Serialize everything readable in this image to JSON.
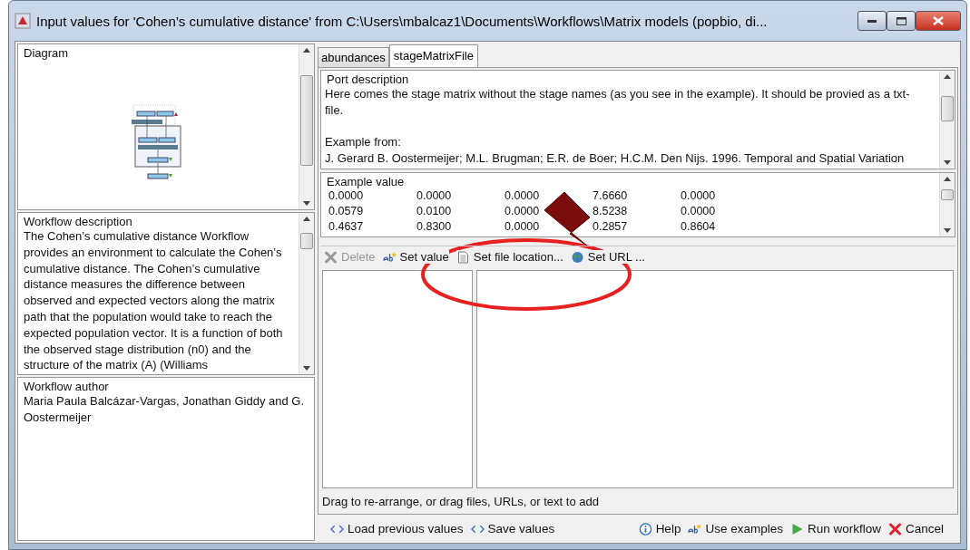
{
  "window": {
    "title": "Input values for 'Cohen’s cumulative distance' from C:\\Users\\mbalcaz1\\Documents\\Workflows\\Matrix models (popbio, di..."
  },
  "diagram": {
    "title": "Diagram"
  },
  "description": {
    "title": "Workflow description",
    "text": "The Cohen’s cumulative distance Workflow provides an environment to calculate the Cohen’s cumulative distance. The Cohen’s cumulative distance measures the difference between observed and expected vectors along the matrix path that the population would take to reach the expected population vector. It is a function of both the observed stage distribution (n0) and the structure of the matrix (A) (Williams"
  },
  "author": {
    "title": "Workflow author",
    "text": "Maria Paula Balcázar-Vargas, Jonathan Giddy and G. Oostermeijer"
  },
  "tabs": [
    {
      "label": "abundances",
      "selected": false
    },
    {
      "label": "stageMatrixFile",
      "selected": true
    }
  ],
  "port_description": {
    "title": "Port description",
    "paragraphs": [
      "Here comes the stage matrix without the stage names (as you see in the example).  It should be provied as a txt-file.",
      "Example from:",
      "J. Gerard B. Oostermeijer; M.L. Brugman; E.R. de Boer; H.C.M. Den Nijs. 1996. Temporal and Spatial Variation"
    ]
  },
  "example_value": {
    "title": "Example value",
    "rows": [
      [
        "0.0000",
        "0.0000",
        "0.0000",
        "7.6660",
        "0.0000"
      ],
      [
        "0.0579",
        "0.0100",
        "0.0000",
        "8.5238",
        "0.0000"
      ],
      [
        "0.4637",
        "0.8300",
        "0.0000",
        "0.2857",
        "0.8604"
      ]
    ]
  },
  "toolbar": [
    {
      "label": "Delete",
      "kind": "delete",
      "disabled": true
    },
    {
      "label": "Set value",
      "kind": "text",
      "disabled": false
    },
    {
      "label": "Set file location...",
      "kind": "file",
      "disabled": false
    },
    {
      "label": "Set URL ...",
      "kind": "globe",
      "disabled": false
    }
  ],
  "hint": "Drag to re-arrange, or drag files, URLs, or text to add",
  "buttons_left": [
    {
      "label": "Load previous values",
      "kind": "code"
    },
    {
      "label": "Save values",
      "kind": "code"
    }
  ],
  "buttons_right": [
    {
      "label": "Help",
      "kind": "info"
    },
    {
      "label": "Use examples",
      "kind": "text"
    },
    {
      "label": "Run workflow",
      "kind": "run"
    },
    {
      "label": "Cancel",
      "kind": "cancel"
    }
  ]
}
